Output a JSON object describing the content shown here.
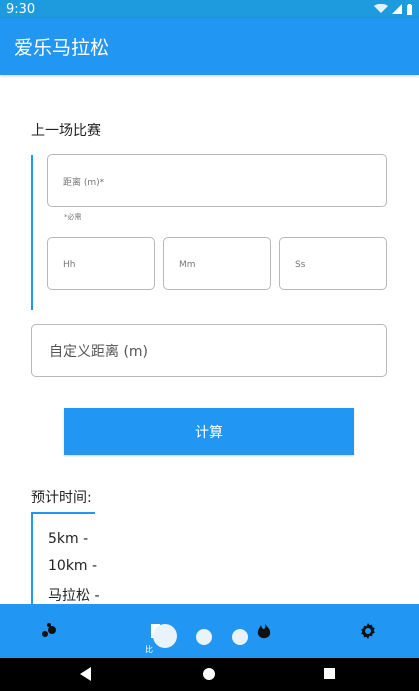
{
  "status": {
    "time": "9:30"
  },
  "app": {
    "title": "爱乐马拉松"
  },
  "form": {
    "section_title": "上一场比赛",
    "distance_placeholder": "距离 (m)*",
    "required_note": "*必需",
    "hh_placeholder": "Hh",
    "mm_placeholder": "Mm",
    "ss_placeholder": "Ss",
    "custom_distance_placeholder": "自定义距离 (m)",
    "calculate_label": "计算"
  },
  "results": {
    "title": "预计时间:",
    "items": [
      "5km -",
      "10km -",
      "马拉松 -"
    ]
  },
  "bottom_nav": {
    "active_label": "比"
  },
  "colors": {
    "primary": "#2196f3",
    "status": "#1e9ade",
    "navigation": "#000000"
  }
}
